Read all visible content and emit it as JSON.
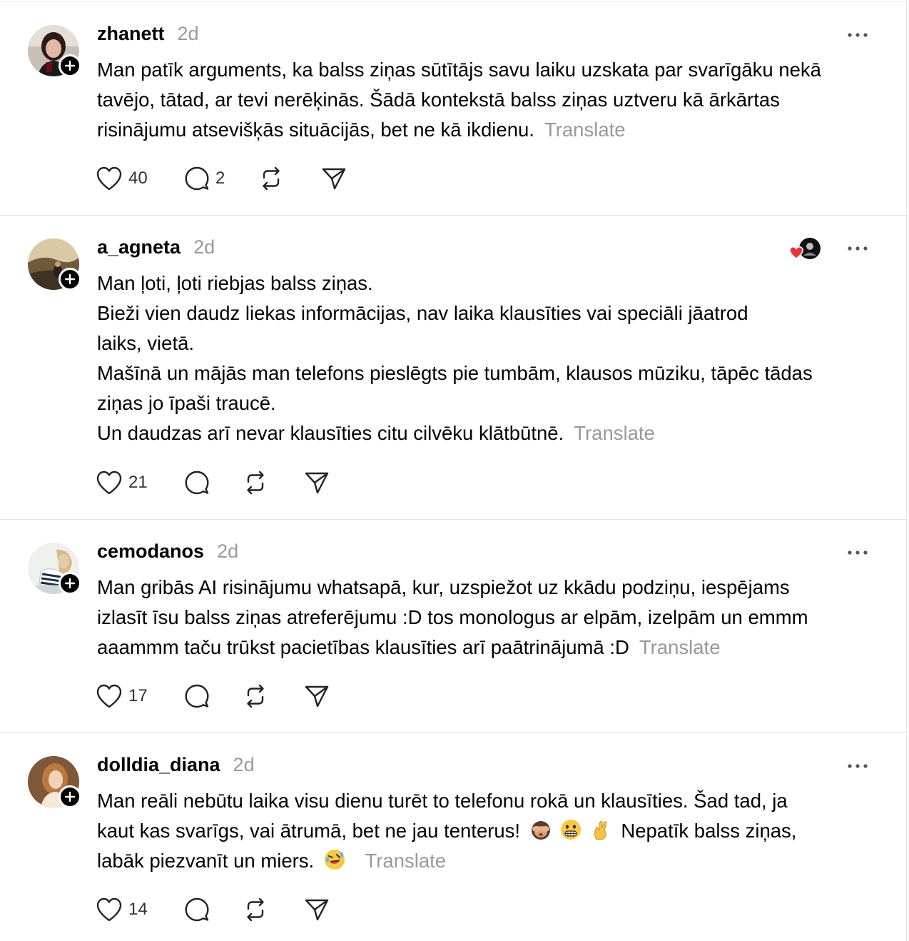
{
  "posts": [
    {
      "username": "zhanett",
      "time": "2d",
      "body": "Man patīk arguments, ka balss ziņas sūtītājs savu laiku uzskata par svarīgāku nekā\ntavējo, tātad, ar tevi nerēķinās. Šādā kontekstā balss ziņas uztveru kā ārkārtas\nrisinājumu atsevišķās situācijās, bet ne kā ikdienu.",
      "translate_label": "Translate",
      "likes": "40",
      "replies": "2"
    },
    {
      "username": "a_agneta",
      "time": "2d",
      "body": "Man ļoti, ļoti riebjas balss ziņas.\nBieži vien daudz liekas informācijas, nav laika klausīties vai speciāli jāatrod\nlaiks, vietā.\nMašīnā un mājās man telefons pieslēgts pie tumbām, klausos mūziku, tāpēc tādas\nziņas jo īpaši traucē.\nUn daudzas arī nevar klausīties citu cilvēku klātbūtnē.",
      "translate_label": "Translate",
      "likes": "21",
      "replies": ""
    },
    {
      "username": "cemodanos",
      "time": "2d",
      "body": "Man gribās AI risinājumu whatsapā, kur, uzspiežot uz kkādu podziņu, iespējams\nizlasīt īsu balss ziņas atreferējumu :D tos monologus ar elpām, izelpām un emmm\naaammm taču trūkst pacietības klausīties arī paātrinājumā :D",
      "translate_label": "Translate",
      "likes": "17",
      "replies": ""
    },
    {
      "username": "dolldia_diana",
      "time": "2d",
      "body_line1": "Man reāli nebūtu laika visu dienu turēt to telefonu rokā un klausīties. Šad tad, ja",
      "body_line2": "kaut kas svarīgs, vai ātrumā, bet ne jau tenterus!",
      "body_line2_end": "Nepatīk balss ziņas,",
      "body_line3": "labāk piezvanīt un miers.",
      "translate_label": "Translate",
      "likes": "14",
      "replies": ""
    }
  ],
  "icons": {
    "like": "heart-outline-icon",
    "reply": "speech-bubble-icon",
    "repost": "repost-arrows-icon",
    "share": "paper-plane-icon",
    "more": "more-dots-icon",
    "follow": "plus-icon"
  },
  "emoji": [
    "see-no-evil-monkey",
    "grimacing-face",
    "crossed-fingers",
    "rolling-on-floor-laughing"
  ],
  "colors": {
    "text": "#000000",
    "muted": "#999999",
    "divider": "#e0e0e0",
    "like_heart_reaction": "#e8323c"
  }
}
